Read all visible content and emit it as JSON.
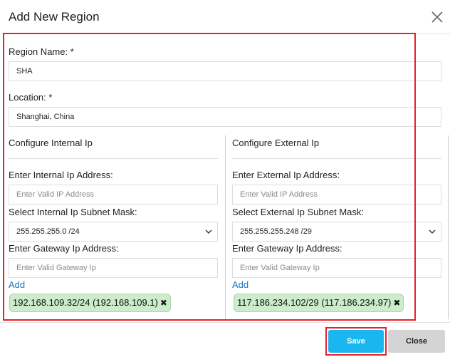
{
  "dialog": {
    "title": "Add New Region"
  },
  "region_name": {
    "label": "Region Name: *",
    "value": "SHA"
  },
  "location": {
    "label": "Location: *",
    "value": "Shanghai, China"
  },
  "internal": {
    "section_title": "Configure Internal Ip",
    "ip_label": "Enter Internal Ip Address:",
    "ip_placeholder": "Enter Valid IP Address",
    "mask_label": "Select Internal Ip Subnet Mask:",
    "mask_value": "255.255.255.0 /24",
    "gateway_label": "Enter Gateway Ip Address:",
    "gateway_placeholder": "Enter Valid Gateway Ip",
    "add_label": "Add",
    "chip": "192.168.109.32/24 (192.168.109.1)"
  },
  "external": {
    "section_title": "Configure External Ip",
    "ip_label": "Enter External Ip Address:",
    "ip_placeholder": "Enter Valid IP Address",
    "mask_label": "Select External Ip Subnet Mask:",
    "mask_value": "255.255.255.248 /29",
    "gateway_label": "Enter Gateway Ip Address:",
    "gateway_placeholder": "Enter Valid Gateway Ip",
    "add_label": "Add",
    "chip": "117.186.234.102/29 (117.186.234.97)"
  },
  "footer": {
    "save_label": "Save",
    "close_label": "Close"
  },
  "icons": {
    "close": "close-icon",
    "chevron": "chevron-down-icon",
    "chip_remove": "remove-chip-icon"
  },
  "colors": {
    "accent": "#1ab6f0",
    "highlight": "#e8202a",
    "chip_bg": "#cdeccc",
    "link": "#1a73c8"
  }
}
